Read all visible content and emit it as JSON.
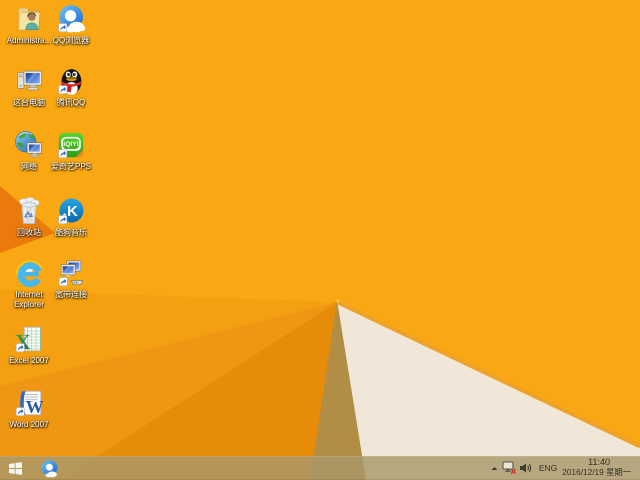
{
  "colors": {
    "wallpaper_base": "#F9A813",
    "wallpaper_facet_mid": "#F4A011",
    "wallpaper_facet_deep": "#EF9712",
    "wallpaper_facet_dark": "#E78C08",
    "wallpaper_left_triangle": "#E97A0B",
    "wallpaper_shadow_facet": "#B28D45",
    "wallpaper_cream_facet": "#F0E7D8",
    "wallpaper_ridge": "#EDA22A",
    "taskbar_tint": "rgba(170,152,104,0.82)",
    "icon_label_text": "#FFFFFF",
    "tray_text": "#33312A"
  },
  "desktop": {
    "columns": [
      {
        "items": [
          {
            "name": "administrator",
            "label": "Administra...",
            "icon": "user-folder-icon"
          },
          {
            "name": "this-pc",
            "label": "这台电脑",
            "icon": "computer-icon"
          },
          {
            "name": "network",
            "label": "网络",
            "icon": "network-globe-icon"
          },
          {
            "name": "recycle-bin",
            "label": "回收站",
            "icon": "recycle-bin-icon"
          },
          {
            "name": "internet-explorer",
            "label": "Internet Explorer",
            "icon": "ie-icon"
          },
          {
            "name": "excel-2007",
            "label": "Excel 2007",
            "icon": "excel-icon",
            "brand_text": "X"
          },
          {
            "name": "word-2007",
            "label": "Word 2007",
            "icon": "word-icon",
            "brand_text": "W"
          }
        ]
      },
      {
        "items": [
          {
            "name": "qq-browser",
            "label": "QQ浏览器",
            "icon": "qq-browser-icon"
          },
          {
            "name": "tencent-qq",
            "label": "腾讯QQ",
            "icon": "qq-penguin-icon"
          },
          {
            "name": "iqiyi-pps",
            "label": "爱奇艺PPS",
            "icon": "iqiyi-icon",
            "brand_text": "iQIYI"
          },
          {
            "name": "kugou-music",
            "label": "酷狗音乐",
            "icon": "kugou-icon",
            "brand_text": "K"
          },
          {
            "name": "broadband-connection",
            "label": "宽带连接",
            "icon": "broadband-icon"
          }
        ]
      }
    ]
  },
  "taskbar": {
    "start": {
      "icon": "windows-flag-icon"
    },
    "pinned": [
      {
        "name": "qq-browser-taskbar",
        "icon": "qq-browser-icon"
      }
    ],
    "tray": {
      "hidden_icons": {
        "icon": "chevron-up-icon"
      },
      "network_status": {
        "icon": "network-disconnected-icon",
        "status": "disconnected"
      },
      "volume": {
        "icon": "speaker-icon"
      },
      "language": "ENG",
      "time": "11:40",
      "date": "2016/12/19 星期一"
    }
  }
}
